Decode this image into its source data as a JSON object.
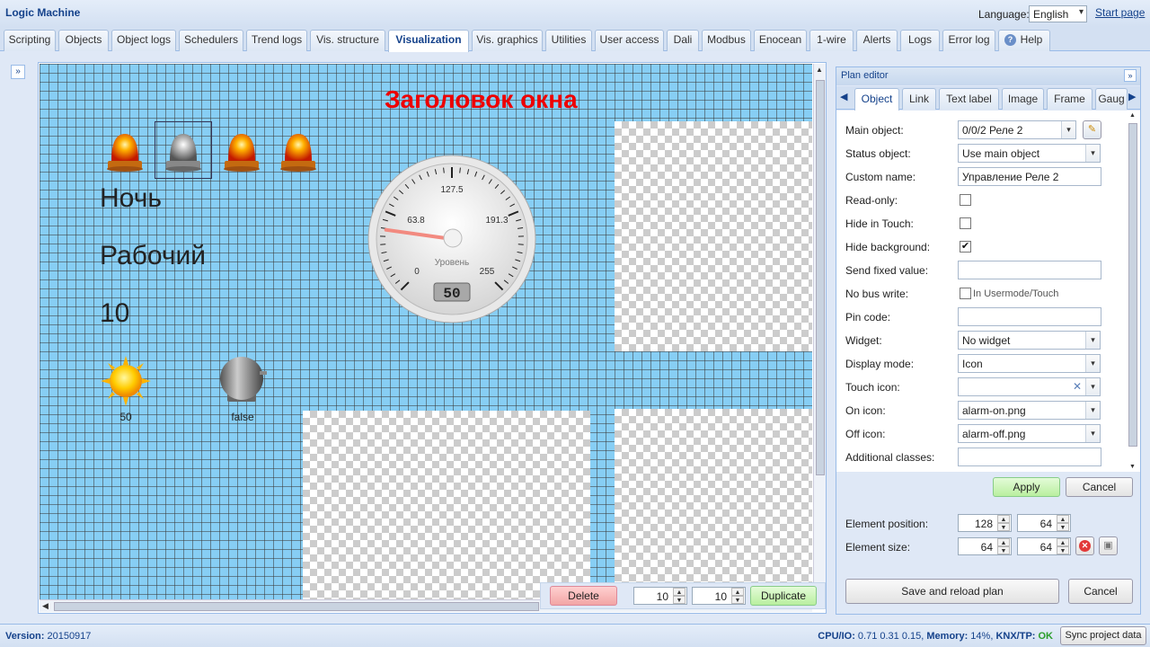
{
  "app": {
    "title": "Logic Machine"
  },
  "header": {
    "language_label": "Language:",
    "language_value": "English",
    "start_page": "Start page"
  },
  "tabs": [
    {
      "label": "Scripting"
    },
    {
      "label": "Objects"
    },
    {
      "label": "Object logs"
    },
    {
      "label": "Schedulers"
    },
    {
      "label": "Trend logs"
    },
    {
      "label": "Vis. structure"
    },
    {
      "label": "Visualization"
    },
    {
      "label": "Vis. graphics"
    },
    {
      "label": "Utilities"
    },
    {
      "label": "User access"
    },
    {
      "label": "Dali"
    },
    {
      "label": "Modbus"
    },
    {
      "label": "Enocean"
    },
    {
      "label": "1-wire"
    },
    {
      "label": "Alerts"
    },
    {
      "label": "Logs"
    },
    {
      "label": "Error log"
    },
    {
      "label": "Help"
    }
  ],
  "canvas": {
    "window_title": "Заголовок окна",
    "text_night": "Ночь",
    "text_work": "Рабочий",
    "text_number": "10",
    "sun_value": "50",
    "bell_value": "false",
    "gauge": {
      "label": "Уровень",
      "min": "0",
      "max": "255",
      "t1": "63.8",
      "t2": "127.5",
      "t3": "191.3",
      "value": "50",
      "value_num": 50,
      "max_num": 255
    }
  },
  "canvas_toolbar": {
    "delete": "Delete",
    "grid_x": "10",
    "grid_y": "10",
    "duplicate": "Duplicate"
  },
  "editor": {
    "title": "Plan editor",
    "tabs": [
      "Object",
      "Link",
      "Text label",
      "Image",
      "Frame",
      "Gaug"
    ],
    "props": {
      "main_object_label": "Main object:",
      "main_object_value": "0/0/2 Реле 2",
      "status_object_label": "Status object:",
      "status_object_value": "Use main object",
      "custom_name_label": "Custom name:",
      "custom_name_value": "Управление Реле 2",
      "read_only_label": "Read-only:",
      "read_only": false,
      "hide_touch_label": "Hide in Touch:",
      "hide_touch": false,
      "hide_bg_label": "Hide background:",
      "hide_bg": true,
      "send_fixed_label": "Send fixed value:",
      "send_fixed_value": "",
      "no_bus_label": "No bus write:",
      "no_bus_hint": "In Usermode/Touch",
      "no_bus": false,
      "pin_label": "Pin code:",
      "pin_value": "",
      "widget_label": "Widget:",
      "widget_value": "No widget",
      "display_mode_label": "Display mode:",
      "display_mode_value": "Icon",
      "touch_icon_label": "Touch icon:",
      "touch_icon_value": "",
      "on_icon_label": "On icon:",
      "on_icon_value": "alarm-on.png",
      "off_icon_label": "Off icon:",
      "off_icon_value": "alarm-off.png",
      "classes_label": "Additional classes:",
      "classes_value": ""
    },
    "apply": "Apply",
    "cancel": "Cancel",
    "position_label": "Element position:",
    "pos_x": "128",
    "pos_y": "64",
    "size_label": "Element size:",
    "size_w": "64",
    "size_h": "64",
    "save_reload": "Save and reload plan",
    "cancel2": "Cancel"
  },
  "status": {
    "version_label": "Version:",
    "version_value": "20150917",
    "cpu_label": "CPU/IO:",
    "cpu_value": "0.71 0.31 0.15,",
    "mem_label": "Memory:",
    "mem_value": "14%,",
    "knx_label": "KNX/TP:",
    "knx_value": "OK",
    "sync": "Sync project data"
  }
}
